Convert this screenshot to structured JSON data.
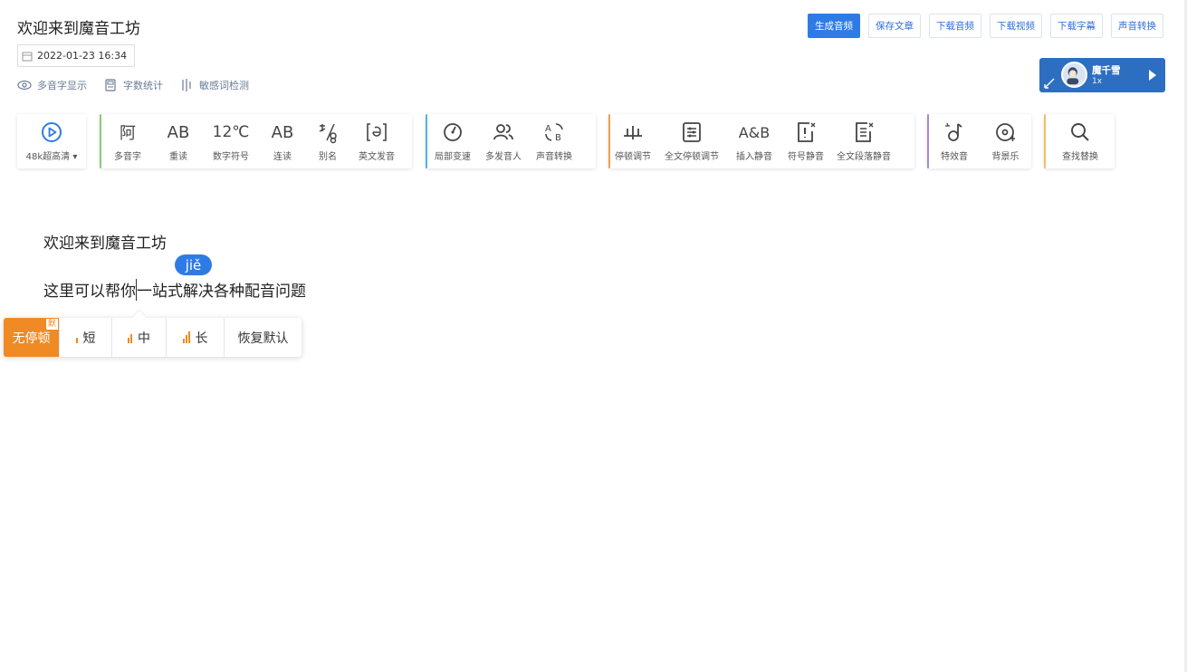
{
  "header": {
    "title": "欢迎来到魔音工坊",
    "datetime": "2022-01-23 16:34",
    "options": [
      {
        "label": "多音字显示",
        "icon": "eye-icon"
      },
      {
        "label": "字数统计",
        "icon": "counter-icon"
      },
      {
        "label": "敏感词检测",
        "icon": "scan-icon"
      }
    ]
  },
  "top_buttons": [
    "生成音频",
    "保存文章",
    "下载音频",
    "下载视频",
    "下载字幕",
    "声音转换"
  ],
  "voice": {
    "name": "魔千雪",
    "speed": "1x"
  },
  "toolbar": {
    "quality": "48k超高清",
    "group1": [
      "多音字",
      "重读",
      "数字符号",
      "连读",
      "别名",
      "英文发音"
    ],
    "group2": [
      "局部变速",
      "多发音人",
      "声音转换"
    ],
    "group3": [
      "停顿调节",
      "全文停顿调节",
      "插入静音",
      "符号静音",
      "全文段落静音"
    ],
    "group4": [
      "特效音",
      "背景乐"
    ],
    "group5": [
      "查找替换"
    ],
    "icon_text": {
      "number": "12℃",
      "polyphone": "阿",
      "stress": "AB",
      "liaison": "AB",
      "insert": "A&B"
    },
    "colors": {
      "g1": "#8cc87a",
      "g2": "#4fb3e8",
      "g3": "#f0a050",
      "g4": "#a58ad8",
      "g5": "#f0c060"
    }
  },
  "editor": {
    "line1": "欢迎来到魔音工坊",
    "line2_before": "这里可以帮你",
    "line2_after": "一站式解决各种配音问题",
    "pinyin": "jiě"
  },
  "pause_popup": {
    "items": [
      "无停顿",
      "短",
      "中",
      "长",
      "恢复默认"
    ],
    "default_badge": "默",
    "accent": "#f08a24"
  }
}
